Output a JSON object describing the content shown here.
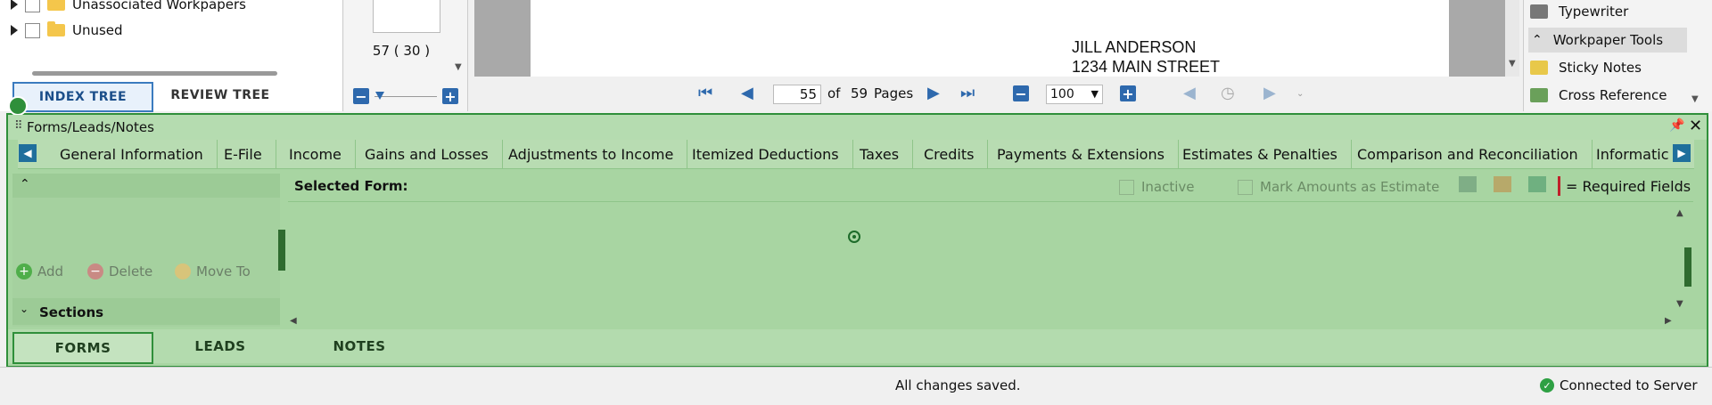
{
  "tree": {
    "items": [
      {
        "label": "Unassociated Workpapers"
      },
      {
        "label": "Unused"
      }
    ],
    "tabs": {
      "index": "INDEX TREE",
      "review": "REVIEW TREE"
    }
  },
  "thumbnail": {
    "caption": "57 ( 30 )"
  },
  "document": {
    "line1": "JILL ANDERSON",
    "line2": "1234 MAIN STREET"
  },
  "nav": {
    "page": "55",
    "of": "of",
    "total": "59",
    "pages_label": "Pages",
    "zoom": "100"
  },
  "tools": {
    "items": [
      {
        "label": "Typewriter",
        "icon": "typewriter-icon"
      },
      {
        "label": "Workpaper Tools",
        "icon": "chevron-up-icon"
      },
      {
        "label": "Sticky Notes",
        "icon": "sticky-notes-icon"
      },
      {
        "label": "Cross Reference",
        "icon": "cross-reference-icon"
      }
    ]
  },
  "panel": {
    "title": "Forms/Leads/Notes",
    "tabs": [
      "General Information",
      "E-File",
      "Income",
      "Gains and Losses",
      "Adjustments to Income",
      "Itemized Deductions",
      "Taxes",
      "Credits",
      "Payments & Extensions",
      "Estimates & Penalties",
      "Comparison and Reconciliation",
      "Informatic"
    ],
    "actions": {
      "add": "Add",
      "delete": "Delete",
      "move": "Move To"
    },
    "sections_label": "Sections",
    "selected_form_label": "Selected Form:",
    "inactive_label": "Inactive",
    "estimate_label": "Mark Amounts as Estimate",
    "required_label": "= Required Fields",
    "bottom_tabs": {
      "forms": "FORMS",
      "leads": "LEADS",
      "notes": "NOTES"
    }
  },
  "status": {
    "message": "All changes saved.",
    "connection": "Connected to Server"
  },
  "colors": {
    "accent": "#2e69ad",
    "panel_green": "#a8d5a2",
    "required_red": "#c0202a"
  }
}
